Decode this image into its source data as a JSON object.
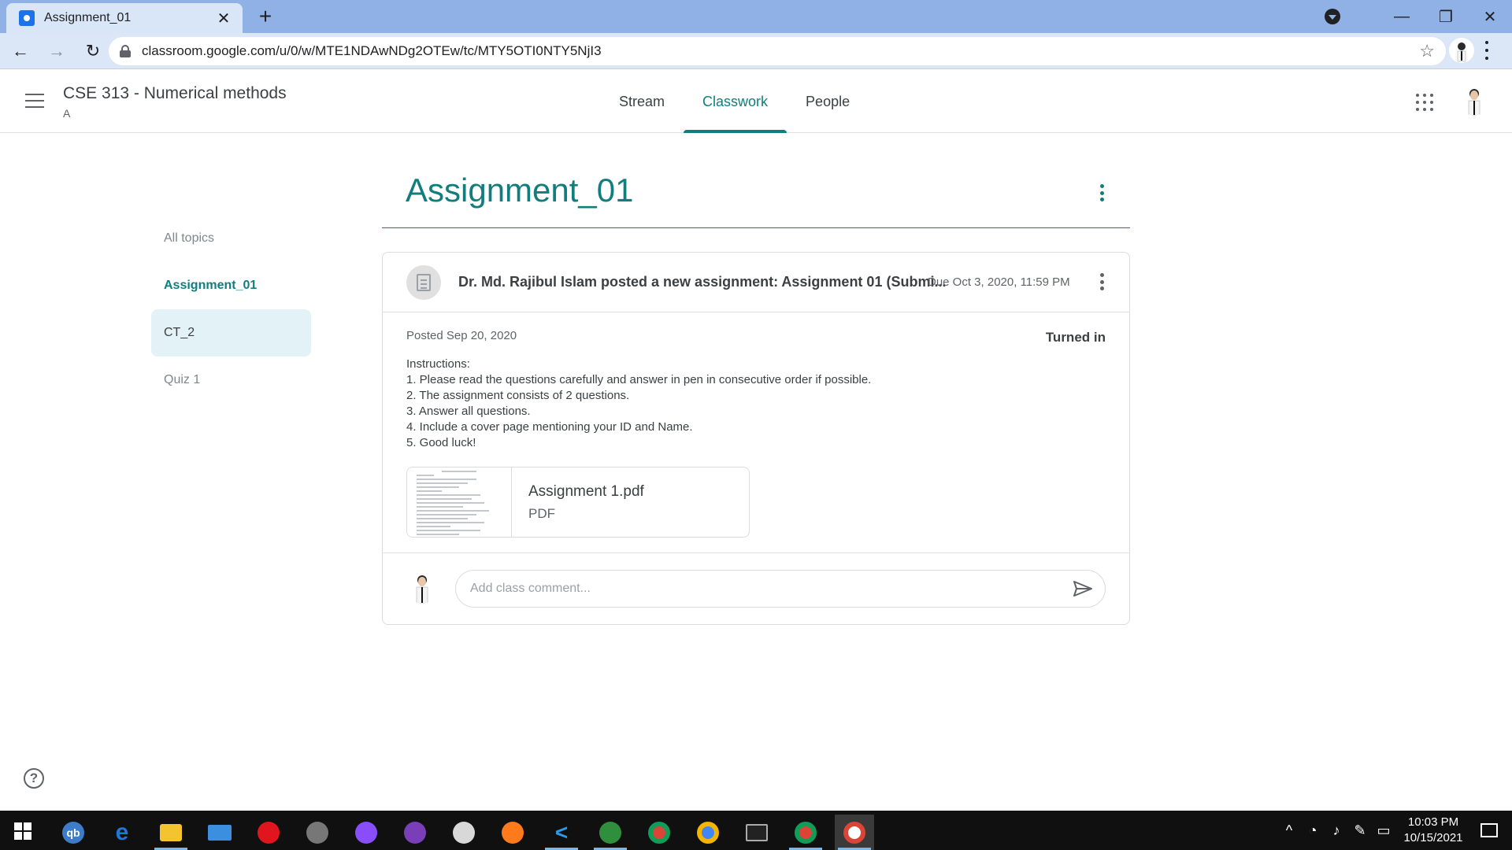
{
  "browser": {
    "tab_title": "Assignment_01",
    "url": "classroom.google.com/u/0/w/MTE1NDAwNDg2OTEw/tc/MTY5OTI0NTY5NjI3"
  },
  "header": {
    "class_name": "CSE 313 - Numerical methods",
    "section": "A",
    "tabs": [
      {
        "label": "Stream"
      },
      {
        "label": "Classwork"
      },
      {
        "label": "People"
      }
    ]
  },
  "topics": [
    {
      "label": "All topics"
    },
    {
      "label": "Assignment_01"
    },
    {
      "label": "CT_2"
    },
    {
      "label": "Quiz 1"
    }
  ],
  "topic_heading": "Assignment_01",
  "assignment": {
    "post_title": "Dr. Md. Rajibul Islam posted a new assignment: Assignment 01 (Submi...",
    "due": "Due Oct 3, 2020, 11:59 PM",
    "posted": "Posted Sep 20, 2020",
    "status": "Turned in",
    "instructions_header": "Instructions:",
    "instructions": [
      "1. Please read the questions carefully and answer in pen in consecutive order if possible.",
      "2. The assignment consists of 2 questions.",
      "3. Answer all questions.",
      "4. Include a cover page mentioning your ID and Name.",
      "5. Good luck!"
    ],
    "attachment": {
      "name": "Assignment 1.pdf",
      "type": "PDF"
    },
    "comment_placeholder": "Add class comment..."
  },
  "taskbar": {
    "time": "10:03 PM",
    "date": "10/15/2021"
  },
  "colors": {
    "accent": "#127d7d",
    "chrome_tab_bar": "#8fb1e6",
    "chrome_toolbar": "#dbe6f6",
    "topic_highlight": "#e3f2f7",
    "taskbar": "#101010"
  }
}
